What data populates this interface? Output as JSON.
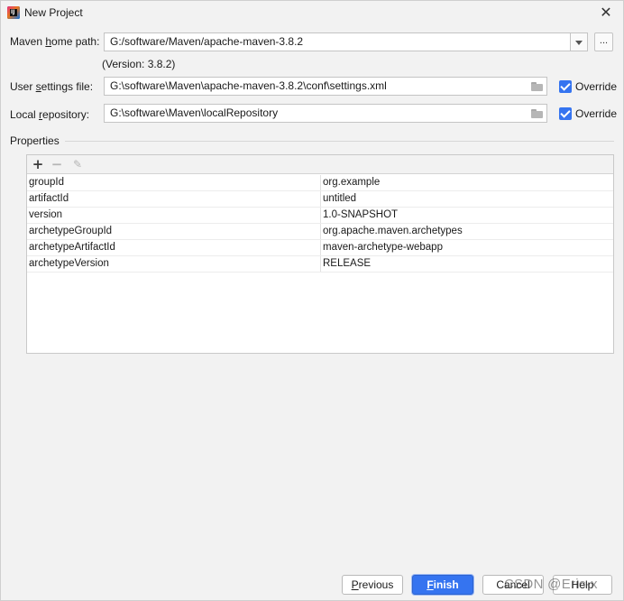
{
  "window": {
    "title": "New Project",
    "close_glyph": "✕"
  },
  "maven_home": {
    "label_pre": "Maven ",
    "label_mnemonic": "h",
    "label_post": "ome path:",
    "value": "G:/software/Maven/apache-maven-3.8.2",
    "version_text": "(Version: 3.8.2)",
    "browse_label": "..."
  },
  "user_settings": {
    "label_pre": "User ",
    "label_mnemonic": "s",
    "label_post": "ettings file:",
    "value": "G:\\software\\Maven\\apache-maven-3.8.2\\conf\\settings.xml",
    "override_label": "Override",
    "override_checked": true
  },
  "local_repo": {
    "label_pre": "Local ",
    "label_mnemonic": "r",
    "label_post": "epository:",
    "value": "G:\\software\\Maven\\localRepository",
    "override_label": "Override",
    "override_checked": true
  },
  "properties": {
    "section_title": "Properties",
    "toolbar": {
      "add": "+",
      "remove": "−",
      "edit": "✎"
    },
    "rows": [
      {
        "key": "groupId",
        "value": "org.example"
      },
      {
        "key": "artifactId",
        "value": "untitled"
      },
      {
        "key": "version",
        "value": "1.0-SNAPSHOT"
      },
      {
        "key": "archetypeGroupId",
        "value": "org.apache.maven.archetypes"
      },
      {
        "key": "archetypeArtifactId",
        "value": "maven-archetype-webapp"
      },
      {
        "key": "archetypeVersion",
        "value": "RELEASE"
      }
    ]
  },
  "buttons": {
    "previous_mnemonic": "P",
    "previous_rest": "revious",
    "finish_mnemonic": "F",
    "finish_rest": "inish",
    "cancel_label": "Cancel",
    "help_label": "Help"
  },
  "watermark": "CSDN @Eric-x",
  "colors": {
    "accent": "#3574f0",
    "background": "#f2f2f2"
  }
}
